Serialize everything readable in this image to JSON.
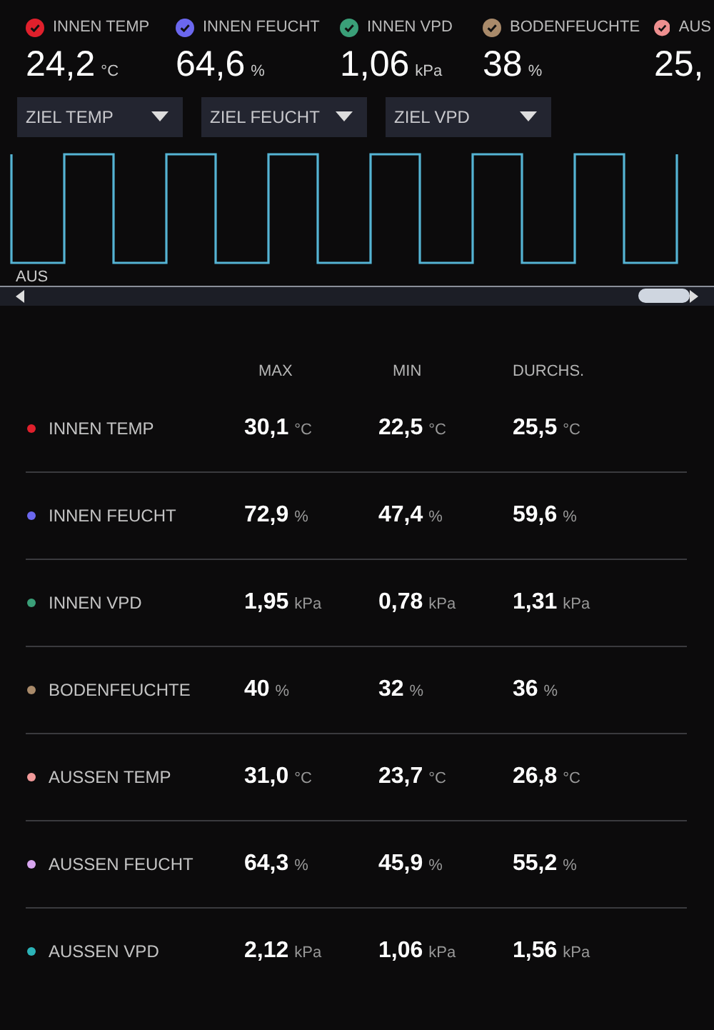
{
  "sensors": [
    {
      "label": "INNEN TEMP",
      "value": "24,2",
      "unit": "°C",
      "color": "#e0202c"
    },
    {
      "label": "INNEN FEUCHT",
      "value": "64,6",
      "unit": "%",
      "color": "#6b67ee"
    },
    {
      "label": "INNEN VPD",
      "value": "1,06",
      "unit": "kPa",
      "color": "#3a9f78"
    },
    {
      "label": "BODENFEUCHTE",
      "value": "38",
      "unit": "%",
      "color": "#a98a6a"
    },
    {
      "label": "AUS",
      "value": "25,",
      "color": "#ee8f8f"
    }
  ],
  "dropdowns": [
    {
      "label": "ZIEL TEMP"
    },
    {
      "label": "ZIEL FEUCHT"
    },
    {
      "label": "ZIEL VPD"
    }
  ],
  "chart": {
    "axis_label": "AUS"
  },
  "table": {
    "columns": [
      "MAX",
      "MIN",
      "DURCHS."
    ],
    "rows": [
      {
        "name": "INNEN TEMP",
        "color": "#e0202c",
        "cells": [
          {
            "value": "30,1",
            "unit": "°C"
          },
          {
            "value": "22,5",
            "unit": "°C"
          },
          {
            "value": "25,5",
            "unit": "°C"
          }
        ]
      },
      {
        "name": "INNEN FEUCHT",
        "color": "#6b67ee",
        "cells": [
          {
            "value": "72,9",
            "unit": "%"
          },
          {
            "value": "47,4",
            "unit": "%"
          },
          {
            "value": "59,6",
            "unit": "%"
          }
        ]
      },
      {
        "name": "INNEN VPD",
        "color": "#3a9f78",
        "cells": [
          {
            "value": "1,95",
            "unit": "kPa"
          },
          {
            "value": "0,78",
            "unit": "kPa"
          },
          {
            "value": "1,31",
            "unit": "kPa"
          }
        ]
      },
      {
        "name": "BODENFEUCHTE",
        "color": "#a98a6a",
        "cells": [
          {
            "value": "40",
            "unit": "%"
          },
          {
            "value": "32",
            "unit": "%"
          },
          {
            "value": "36",
            "unit": "%"
          }
        ]
      },
      {
        "name": "AUSSEN TEMP",
        "color": "#f29a9a",
        "cells": [
          {
            "value": "31,0",
            "unit": "°C"
          },
          {
            "value": "23,7",
            "unit": "°C"
          },
          {
            "value": "26,8",
            "unit": "°C"
          }
        ]
      },
      {
        "name": "AUSSEN FEUCHT",
        "color": "#d8a6f0",
        "cells": [
          {
            "value": "64,3",
            "unit": "%"
          },
          {
            "value": "45,9",
            "unit": "%"
          },
          {
            "value": "55,2",
            "unit": "%"
          }
        ]
      },
      {
        "name": "AUSSEN VPD",
        "color": "#2bb3b8",
        "cells": [
          {
            "value": "2,12",
            "unit": "kPa"
          },
          {
            "value": "1,06",
            "unit": "kPa"
          },
          {
            "value": "1,56",
            "unit": "kPa"
          }
        ]
      }
    ]
  }
}
